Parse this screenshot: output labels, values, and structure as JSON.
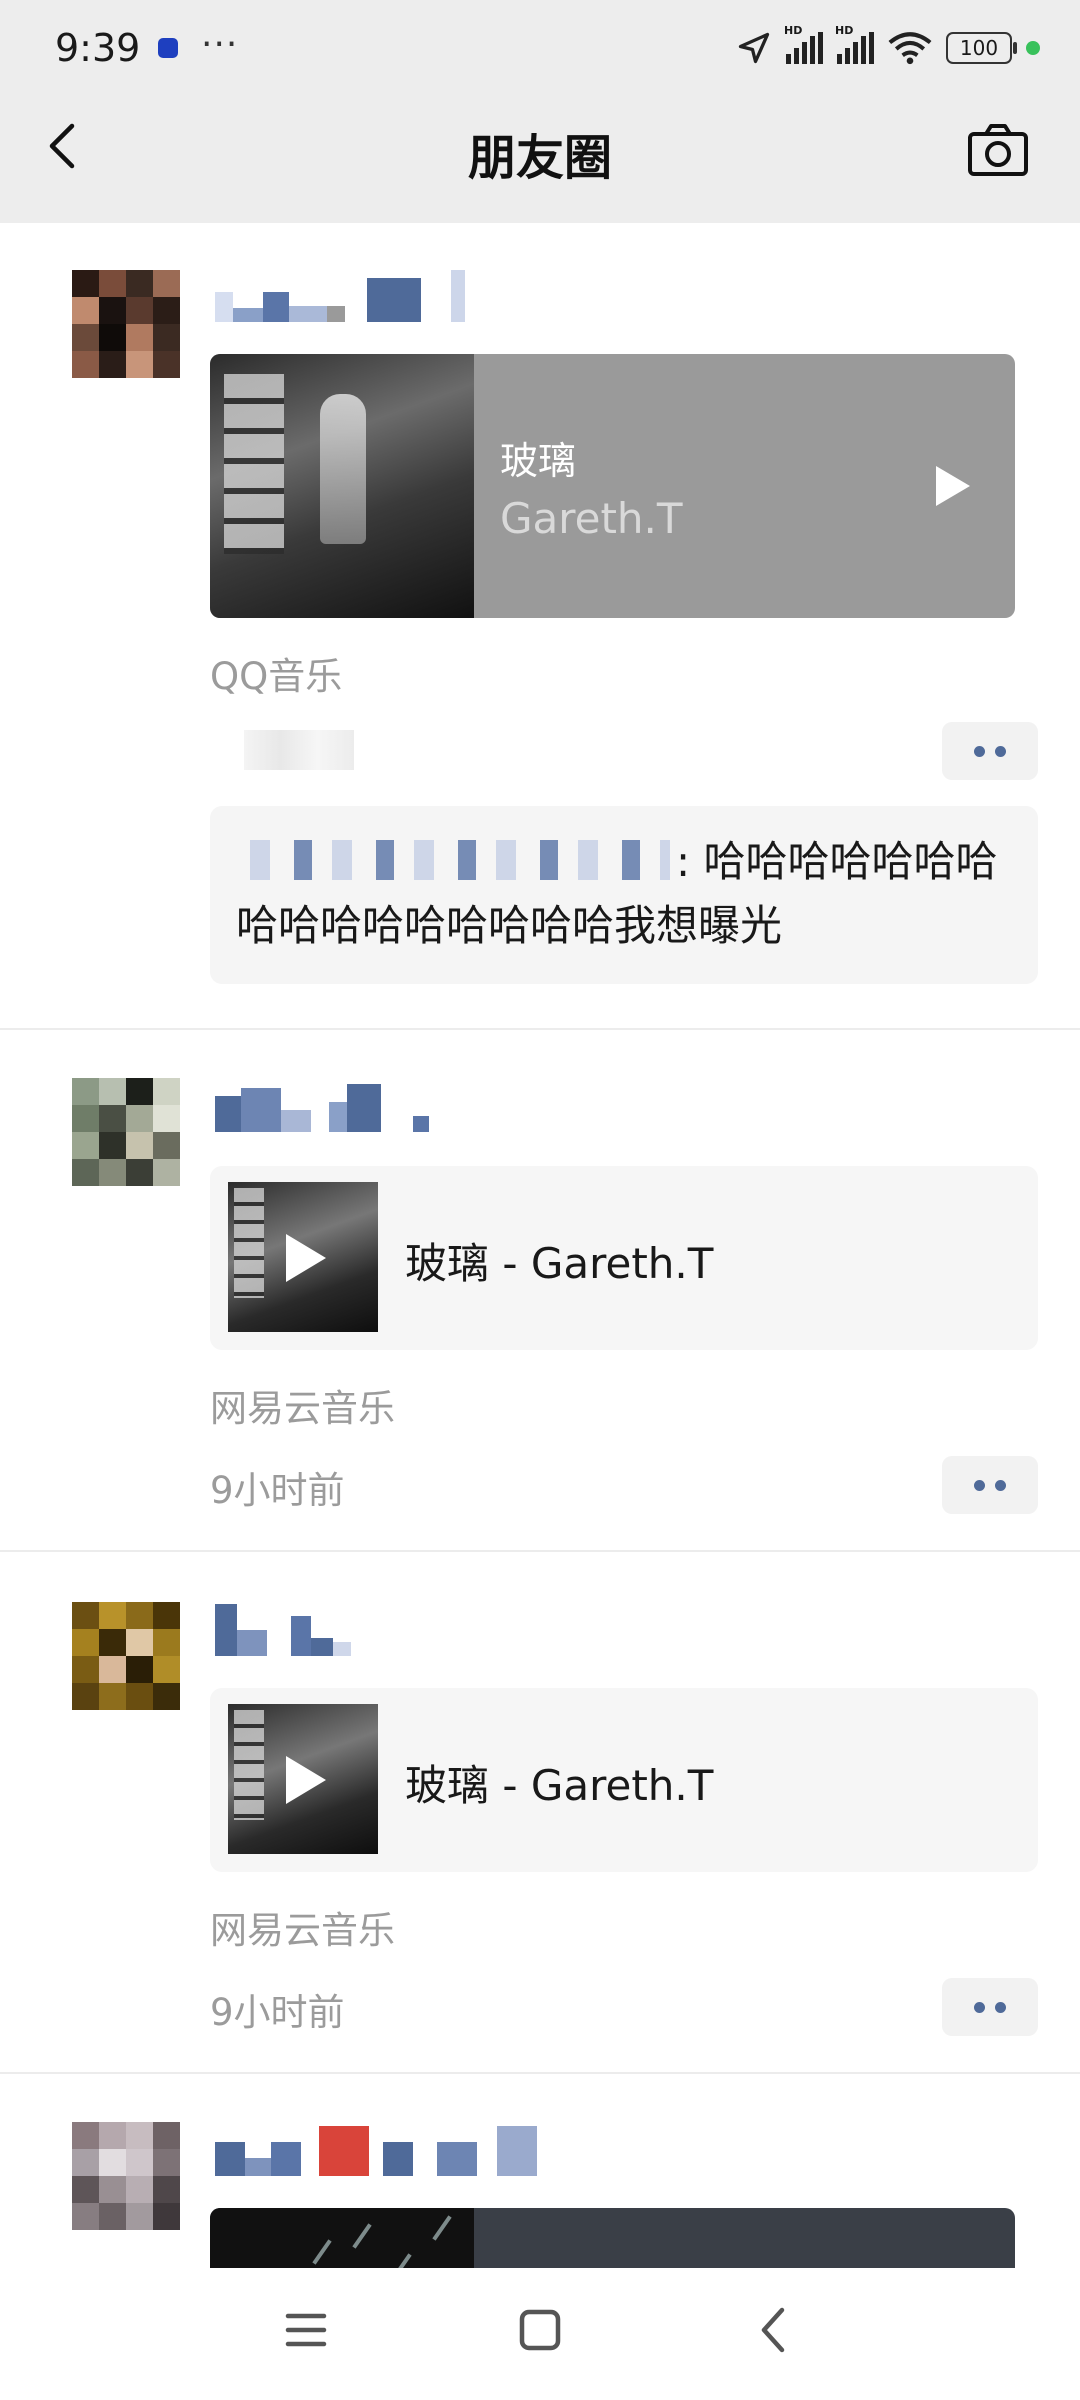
{
  "status_bar": {
    "time": "9:39",
    "more": "···",
    "battery": "100"
  },
  "nav": {
    "title": "朋友圈"
  },
  "posts": [
    {
      "share": {
        "title": "玻璃",
        "artist": "Gareth.T"
      },
      "source": "QQ音乐",
      "comment": {
        "text": ": 哈哈哈哈哈哈哈哈哈哈哈哈哈哈哈哈我想曝光"
      }
    },
    {
      "music": {
        "label": "玻璃 - Gareth.T"
      },
      "source": "网易云音乐",
      "time": "9小时前"
    },
    {
      "music": {
        "label": "玻璃 - Gareth.T"
      },
      "source": "网易云音乐",
      "time": "9小时前"
    }
  ],
  "icons": [
    "back-icon",
    "camera-icon",
    "play-icon",
    "more-icon",
    "menu-icon",
    "home-icon",
    "nav-back-icon",
    "location-icon",
    "signal-icon",
    "wifi-icon",
    "battery-icon"
  ],
  "colors": {
    "nav_bg": "#ededed",
    "link_blue": "#4f6a99",
    "meta_gray": "#9b9b9b",
    "card_gray": "#9a9a9a"
  }
}
